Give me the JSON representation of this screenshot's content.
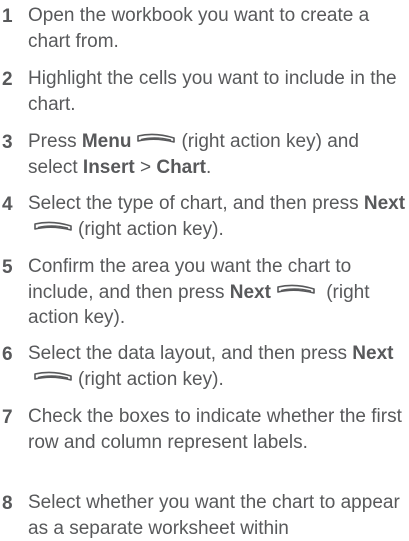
{
  "steps": [
    {
      "number": "1",
      "text": "Open the workbook you want to create a chart from."
    },
    {
      "number": "2",
      "text": "Highlight the cells you want to include in the chart."
    },
    {
      "number": "3",
      "t_press": "Press",
      "menu": "Menu",
      "t_after_key": "(right action key) and select",
      "insert": "Insert",
      "sep": ">",
      "chart": "Chart",
      "end": "."
    },
    {
      "number": "4",
      "t_before": "Select the type of chart, and then press",
      "next": "Next",
      "t_after_key": "(right action key)."
    },
    {
      "number": "5",
      "t_before": "Confirm the area you want the chart to include, and then press",
      "next": "Next",
      "t_after_key": "(right action key)."
    },
    {
      "number": "6",
      "t_before": "Select the data layout, and then press",
      "next": "Next",
      "t_after_key": "(right action key)."
    },
    {
      "number": "7",
      "text": "Check the boxes to indicate whether the first row and column represent labels."
    },
    {
      "number": "8",
      "text": "Select whether you want the chart to appear as a separate worksheet within"
    }
  ],
  "icons": {
    "action_key": "right-action-key-icon"
  },
  "colors": {
    "text": "#58595b"
  }
}
